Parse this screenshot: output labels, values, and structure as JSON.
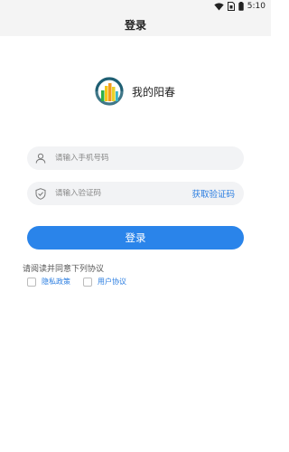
{
  "status_bar": {
    "time": "5:10",
    "icons": [
      "wifi-icon",
      "sim-card-icon",
      "battery-icon"
    ]
  },
  "header": {
    "title": "登录"
  },
  "brand": {
    "name": "我的阳春",
    "logo_icon": "city-logo-icon"
  },
  "form": {
    "phone": {
      "placeholder": "请输入手机号码",
      "value": "",
      "icon": "user-icon"
    },
    "code": {
      "placeholder": "请输入验证码",
      "value": "",
      "icon": "shield-icon",
      "get_code_label": "获取验证码"
    },
    "login_label": "登录"
  },
  "agreement": {
    "title": "请阅读并同意下列协议",
    "items": [
      {
        "label": "隐私政策",
        "checked": false
      },
      {
        "label": "用户协议",
        "checked": false
      }
    ]
  },
  "colors": {
    "accent": "#2a84ea",
    "link": "#2a7de1",
    "input_bg": "#f2f3f5",
    "header_bg": "#f4f4f4"
  }
}
